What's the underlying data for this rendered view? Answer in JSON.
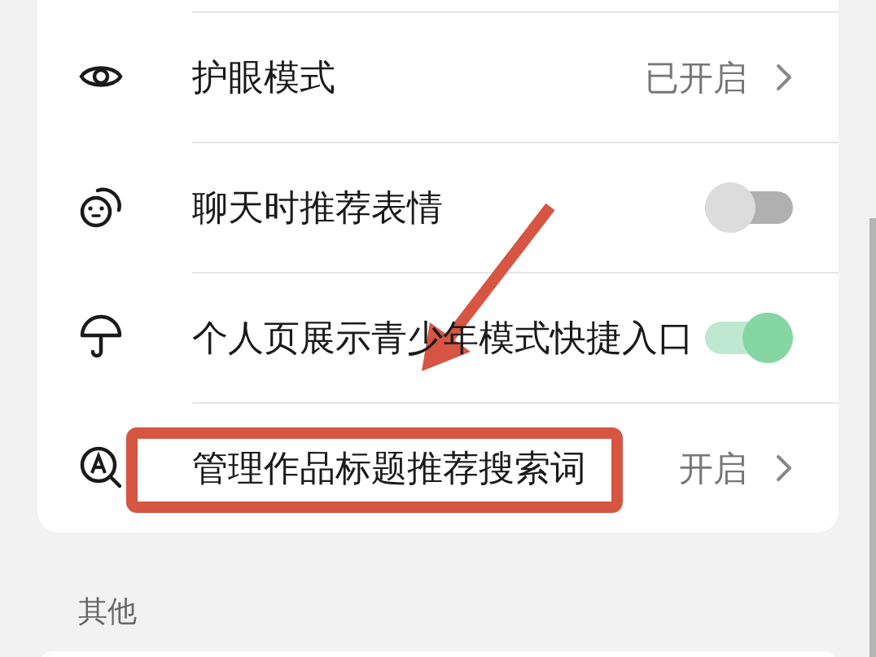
{
  "settings_rows": [
    {
      "kind": "value",
      "title": "护眼模式",
      "value": "已开启"
    },
    {
      "kind": "toggle",
      "title": "聊天时推荐表情",
      "on": false
    },
    {
      "kind": "toggle",
      "title": "个人页展示青少年模式快捷入口",
      "on": true
    },
    {
      "kind": "value",
      "title": "管理作品标题推荐搜索词",
      "value": "开启"
    }
  ],
  "section_header": "其他"
}
